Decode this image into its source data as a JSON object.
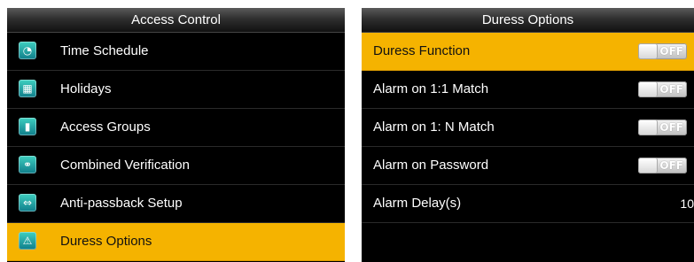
{
  "left": {
    "title": "Access Control",
    "items": [
      {
        "label": "Time Schedule",
        "glyph": "◔"
      },
      {
        "label": "Holidays",
        "glyph": "▦"
      },
      {
        "label": "Access Groups",
        "glyph": "▮"
      },
      {
        "label": "Combined Verification",
        "glyph": "⚭"
      },
      {
        "label": "Anti-passback Setup",
        "glyph": "⇔"
      },
      {
        "label": "Duress Options",
        "glyph": "⚠"
      }
    ],
    "selected_index": 5
  },
  "right": {
    "title": "Duress Options",
    "options": [
      {
        "label": "Duress Function",
        "state": "OFF"
      },
      {
        "label": "Alarm on 1:1 Match",
        "state": "OFF"
      },
      {
        "label": "Alarm on 1: N Match",
        "state": "OFF"
      },
      {
        "label": "Alarm on Password",
        "state": "OFF"
      }
    ],
    "delay": {
      "label": "Alarm Delay(s)",
      "value": "10"
    }
  },
  "colors": {
    "highlight": "#f5b300",
    "background": "#000000"
  }
}
